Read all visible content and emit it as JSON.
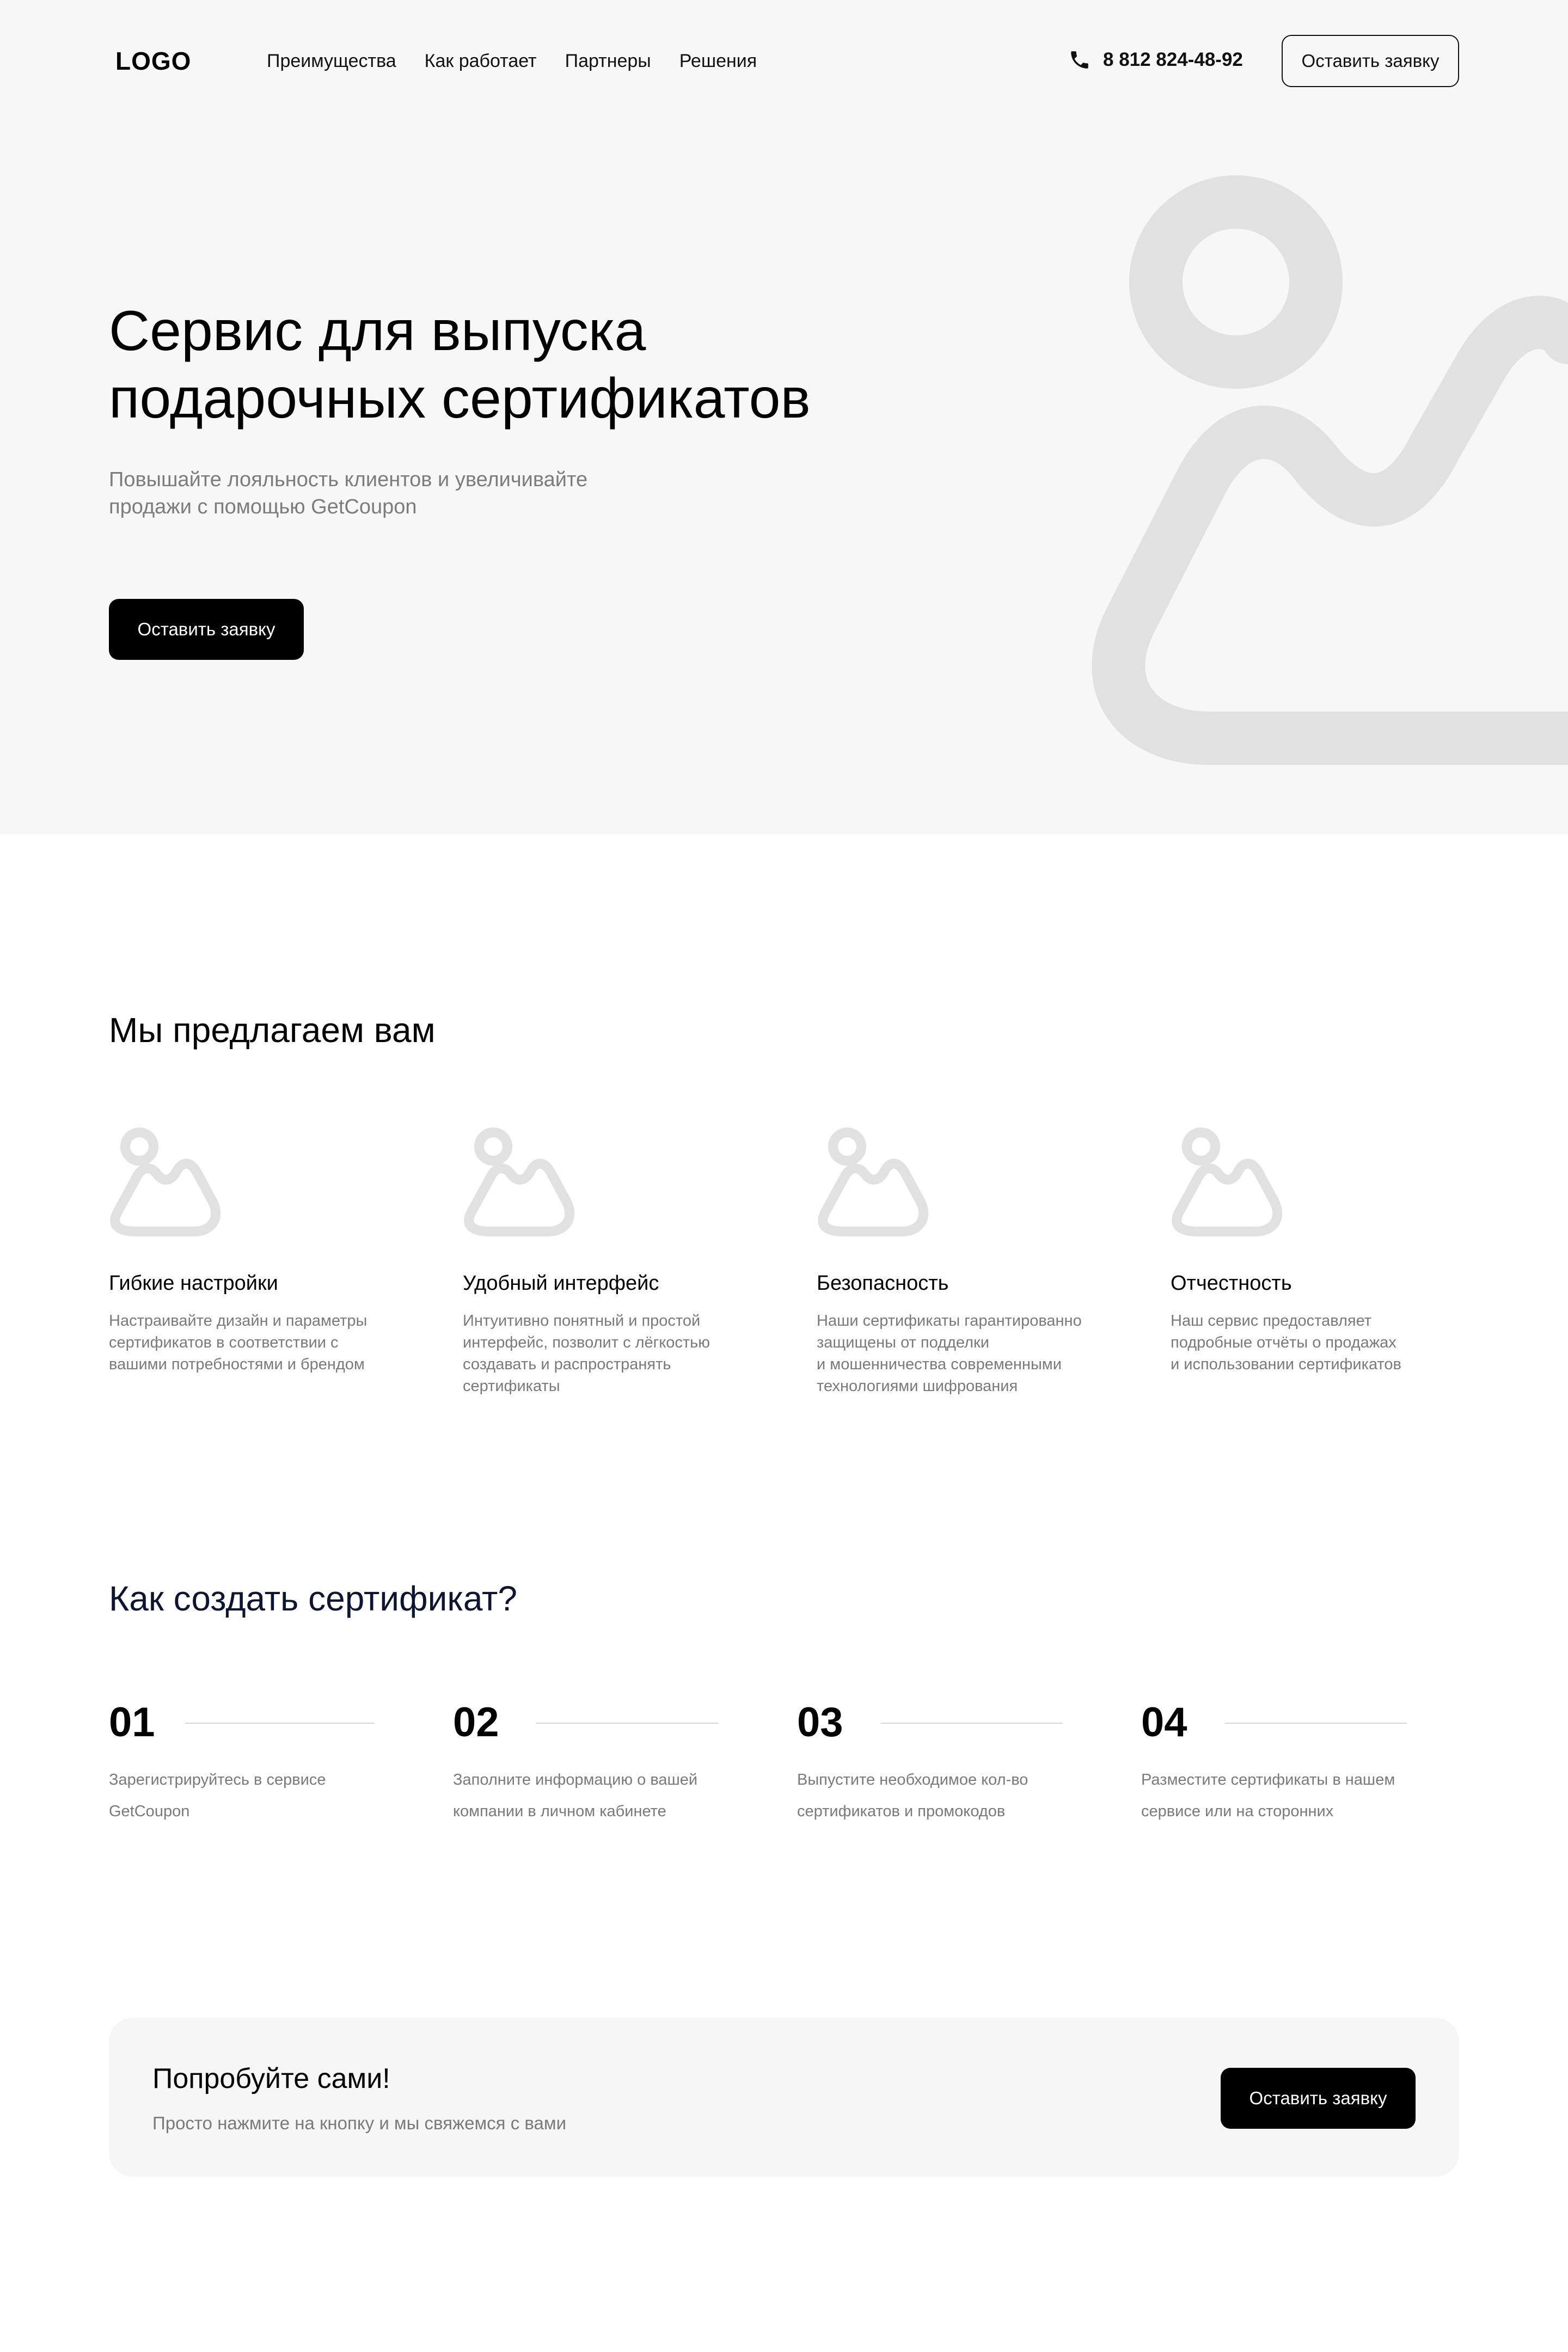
{
  "header": {
    "logo": "LOGO",
    "nav": [
      "Преимущества",
      "Как работает",
      "Партнеры",
      "Решения"
    ],
    "phone_icon": "phone-icon",
    "phone": "8 812 824-48-92",
    "cta_label": "Оставить заявку"
  },
  "hero": {
    "title_line1": "Сервис для выпуска",
    "title_line2": "подарочных сертификатов",
    "subtitle_line1": "Повышайте лояльность клиентов и увеличивайте",
    "subtitle_line2": "продажи с помощью GetCoupon",
    "cta_label": "Оставить заявку",
    "image_icon": "image-placeholder-icon",
    "colors": {
      "background": "#f7f7f7",
      "placeholder": "#e1e1e1",
      "button": "#000000"
    }
  },
  "offers": {
    "title": "Мы предлагаем вам",
    "items": [
      {
        "icon": "image-placeholder-icon",
        "title": "Гибкие настройки",
        "lines": [
          "Настраивайте дизайн и параметры",
          "сертификатов в соответствии с",
          "вашими потребностями и брендом"
        ]
      },
      {
        "icon": "image-placeholder-icon",
        "title": "Удобный интерфейс",
        "lines": [
          "Интуитивно понятный и простой",
          "интерфейс, позволит с лёгкостью",
          "создавать и распространять",
          "сертификаты"
        ]
      },
      {
        "icon": "image-placeholder-icon",
        "title": "Безопасность",
        "lines": [
          "Наши сертификаты гарантированно",
          "защищены от подделки",
          "и мошенничества современными",
          "технологиями шифрования"
        ]
      },
      {
        "icon": "image-placeholder-icon",
        "title": "Отчестность",
        "lines": [
          "Наш сервис предоставляет",
          "подробные отчёты о продажах",
          "и использовании сертификатов"
        ]
      }
    ]
  },
  "steps": {
    "title": "Как создать сертификат?",
    "items": [
      {
        "num": "01",
        "lines": [
          "Зарегистрируйтесь  в сервисе",
          "GetCoupon"
        ]
      },
      {
        "num": "02",
        "lines": [
          "Заполните информацию  о вашей",
          "компании  в личном кабинете"
        ]
      },
      {
        "num": "03",
        "lines": [
          "Выпустите необходимое кол-во",
          "сертификатов  и промокодов"
        ]
      },
      {
        "num": "04",
        "lines": [
          "Разместите сертификаты  в нашем",
          "сервисе или на сторонних"
        ]
      }
    ]
  },
  "cta": {
    "title": "Попробуйте сами!",
    "text": "Просто нажмите на кнопку и мы свяжемся с вами",
    "button_label": "Оставить заявку"
  }
}
